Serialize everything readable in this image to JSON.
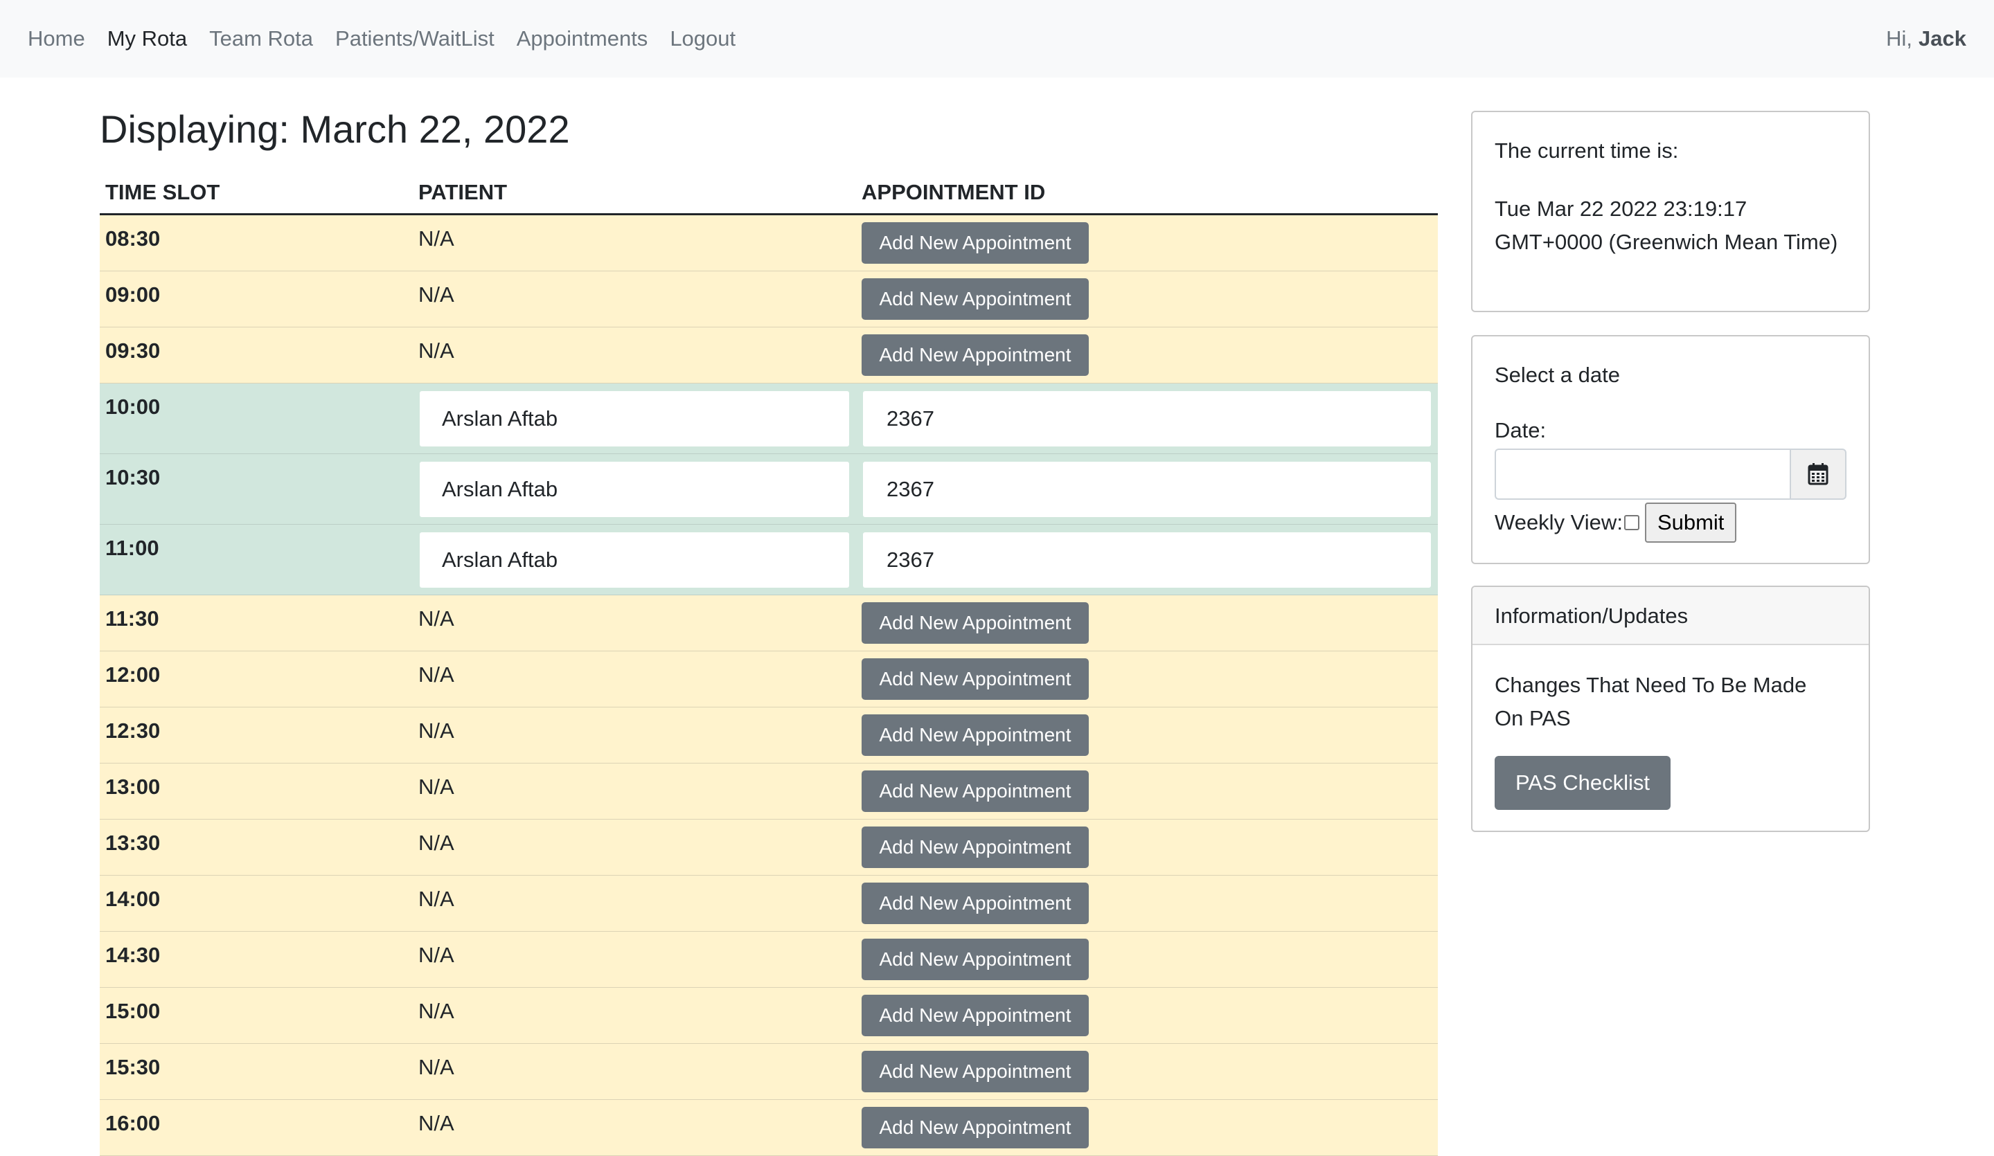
{
  "nav": {
    "links": [
      "Home",
      "My Rota",
      "Team Rota",
      "Patients/WaitList",
      "Appointments",
      "Logout"
    ],
    "active": "My Rota",
    "greeting_prefix": "Hi,",
    "user_name": "Jack"
  },
  "main": {
    "title": "Displaying: March 22, 2022",
    "columns": [
      "TIME SLOT",
      "PATIENT",
      "APPOINTMENT ID"
    ],
    "add_button_label": "Add New Appointment",
    "rows": [
      {
        "time": "08:30",
        "patient": "N/A",
        "appointment_id": null
      },
      {
        "time": "09:00",
        "patient": "N/A",
        "appointment_id": null
      },
      {
        "time": "09:30",
        "patient": "N/A",
        "appointment_id": null
      },
      {
        "time": "10:00",
        "patient": "Arslan Aftab",
        "appointment_id": "2367"
      },
      {
        "time": "10:30",
        "patient": "Arslan Aftab",
        "appointment_id": "2367"
      },
      {
        "time": "11:00",
        "patient": "Arslan Aftab",
        "appointment_id": "2367"
      },
      {
        "time": "11:30",
        "patient": "N/A",
        "appointment_id": null
      },
      {
        "time": "12:00",
        "patient": "N/A",
        "appointment_id": null
      },
      {
        "time": "12:30",
        "patient": "N/A",
        "appointment_id": null
      },
      {
        "time": "13:00",
        "patient": "N/A",
        "appointment_id": null
      },
      {
        "time": "13:30",
        "patient": "N/A",
        "appointment_id": null
      },
      {
        "time": "14:00",
        "patient": "N/A",
        "appointment_id": null
      },
      {
        "time": "14:30",
        "patient": "N/A",
        "appointment_id": null
      },
      {
        "time": "15:00",
        "patient": "N/A",
        "appointment_id": null
      },
      {
        "time": "15:30",
        "patient": "N/A",
        "appointment_id": null
      },
      {
        "time": "16:00",
        "patient": "N/A",
        "appointment_id": null
      }
    ]
  },
  "sidebar": {
    "time_card": {
      "label": "The current time is:",
      "value": "Tue Mar 22 2022 23:19:17 GMT+0000 (Greenwich Mean Time)"
    },
    "date_card": {
      "title": "Select a date",
      "date_label": "Date:",
      "date_value": "",
      "calendar_icon": "calendar-icon",
      "weekly_label": "Weekly View:",
      "weekly_checked": false,
      "submit_label": "Submit"
    },
    "info_card": {
      "header": "Information/Updates",
      "text": "Changes That Need To Be Made On PAS",
      "button_label": "PAS Checklist"
    }
  },
  "colors": {
    "free_row": "#fff3cd",
    "booked_row": "#d1e7dd",
    "button_secondary": "#6c757d",
    "navbar": "#f8f9fa"
  }
}
